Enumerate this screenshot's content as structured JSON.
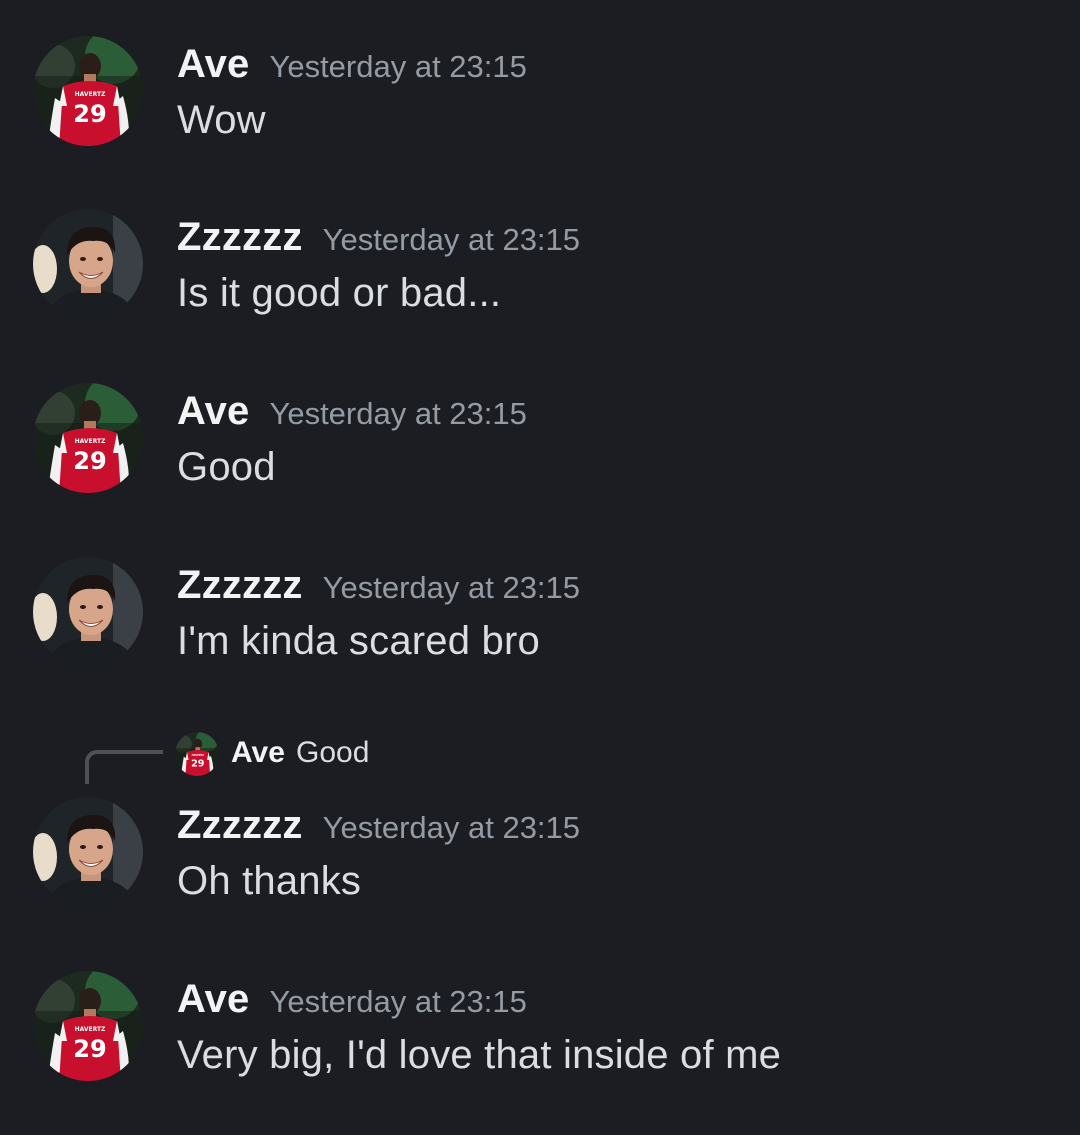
{
  "messages": [
    {
      "author": "Ave",
      "timestamp": "Yesterday at 23:15",
      "text": "Wow",
      "avatar": "ave-avatar"
    },
    {
      "author": "Zzzzzz",
      "timestamp": "Yesterday at 23:15",
      "text": "Is it good or bad...",
      "avatar": "zzzzzz-avatar"
    },
    {
      "author": "Ave",
      "timestamp": "Yesterday at 23:15",
      "text": "Good",
      "avatar": "ave-avatar"
    },
    {
      "author": "Zzzzzz",
      "timestamp": "Yesterday at 23:15",
      "text": "I'm kinda scared bro",
      "avatar": "zzzzzz-avatar"
    },
    {
      "author": "Zzzzzz",
      "timestamp": "Yesterday at 23:15",
      "text": "Oh thanks",
      "avatar": "zzzzzz-avatar",
      "reply_to": {
        "author": "Ave",
        "text": "Good"
      }
    },
    {
      "author": "Ave",
      "timestamp": "Yesterday at 23:15",
      "text": "Very big, I'd love that inside of me",
      "avatar": "ave-avatar"
    }
  ],
  "avatars": {
    "ave": {
      "jersey_name": "HAVERTZ",
      "jersey_number": "29",
      "jersey_color": "#c8102e"
    },
    "zzzzzz": {
      "description_icon": "person-photo-icon"
    }
  },
  "colors": {
    "background": "#1c1d22",
    "author": "#f2f3f5",
    "timestamp": "#949ba4",
    "message_text": "#dbdee1",
    "reply_spine": "#4e5058"
  }
}
